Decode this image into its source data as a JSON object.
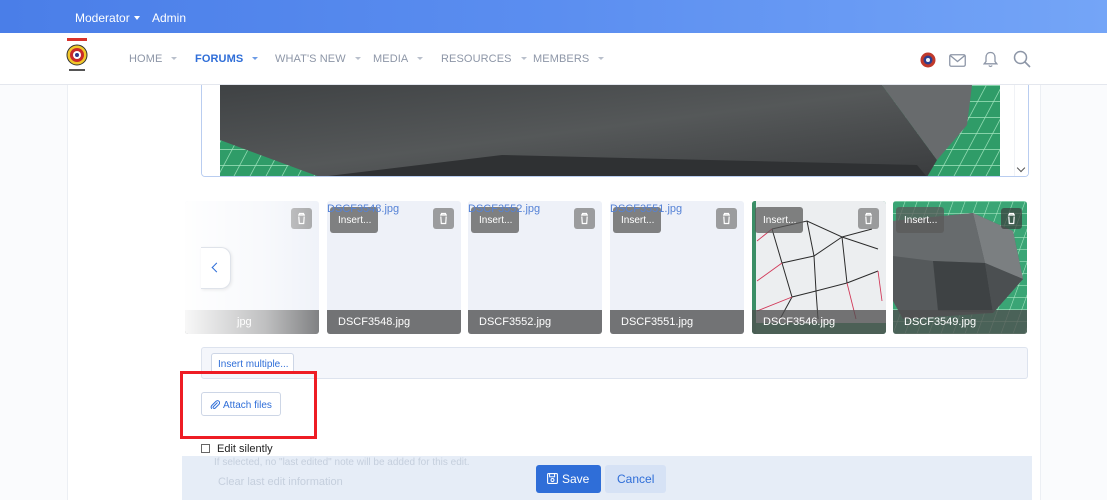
{
  "topbar": {
    "moderator_label": "Moderator",
    "admin_label": "Admin"
  },
  "nav": {
    "items": [
      {
        "label": "HOME"
      },
      {
        "label": "FORUMS"
      },
      {
        "label": "WHAT'S NEW"
      },
      {
        "label": "MEDIA"
      },
      {
        "label": "RESOURCES"
      },
      {
        "label": "MEMBERS"
      }
    ],
    "active_item": "FORUMS",
    "accent_color": "#2f6ed8"
  },
  "attachments": {
    "items": [
      {
        "filename": "jpg",
        "insert_label": "",
        "top_label": ""
      },
      {
        "filename": "DSCF3548.jpg",
        "insert_label": "Insert...",
        "top_label": "DSCF3548.jpg"
      },
      {
        "filename": "DSCF3552.jpg",
        "insert_label": "Insert...",
        "top_label": "DSCF3552.jpg"
      },
      {
        "filename": "DSCF3551.jpg",
        "insert_label": "Insert...",
        "top_label": "DSCF3551.jpg"
      },
      {
        "filename": "DSCF3546.jpg",
        "insert_label": "Insert..."
      },
      {
        "filename": "DSCF3549.jpg",
        "insert_label": "Insert..."
      }
    ]
  },
  "toolbar": {
    "insert_multiple_label": "Insert multiple...",
    "attach_files_label": "Attach files"
  },
  "options": {
    "edit_silently_label": "Edit silently",
    "edit_silently_hint": "If selected, no \"last edited\" note will be added for this edit.",
    "clear_last_edit_label": "Clear last edit information"
  },
  "actions": {
    "save_label": "Save",
    "cancel_label": "Cancel"
  }
}
